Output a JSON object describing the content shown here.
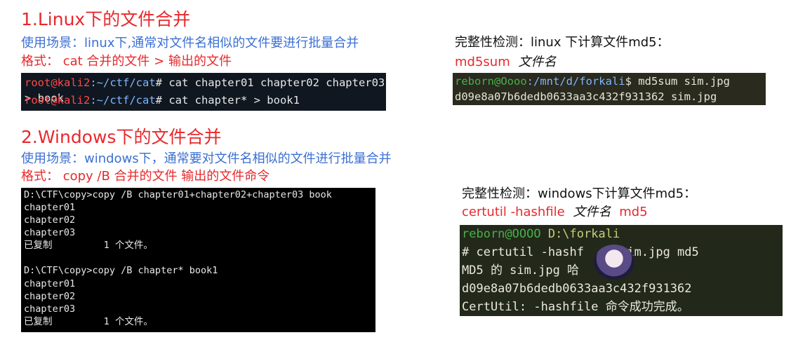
{
  "section1": {
    "title": "1.Linux下的文件合并",
    "usage": "使用场景：linux下,通常对文件名相似的文件要进行批量合并",
    "format": "格式： cat 合并的文件 > 输出的文件",
    "terminal": {
      "line1_prompt_user": "root@kali2",
      "line1_prompt_path": ":~/ctf/cat",
      "line1_cmd": "# cat chapter01 chapter02 chapter03 > book",
      "line2_prompt_user": "root@kali2",
      "line2_prompt_path": ":~/ctf/cat",
      "line2_cmd": "# cat chapter* > book1"
    }
  },
  "integrity_linux": {
    "title": "完整性检测：linux 下计算文件md5：",
    "cmd_label": "md5sum",
    "cmd_arg": "文件名",
    "terminal": {
      "prompt_user": "reborn@Oooo",
      "prompt_path": ":/mnt/d/forkali",
      "prompt_cmd": "$ md5sum sim.jpg",
      "output": "d09e8a07b6dedb0633aa3c432f931362  sim.jpg"
    }
  },
  "section2": {
    "title": "2.Windows下的文件合并",
    "usage": "使用场景：windows下，通常要对文件名相似的文件进行批量合并",
    "format": "格式： copy /B 合并的文件 输出的文件命令",
    "terminal": {
      "lines": [
        "D:\\CTF\\copy>copy /B chapter01+chapter02+chapter03 book",
        "chapter01",
        "chapter02",
        "chapter03",
        "已复制         1 个文件。",
        "",
        "D:\\CTF\\copy>copy /B chapter* book1",
        "chapter01",
        "chapter02",
        "chapter03",
        "已复制         1 个文件。"
      ]
    }
  },
  "integrity_windows": {
    "title": "完整性检测：windows下计算文件md5：",
    "cmd_label": "certutil -hashfile",
    "cmd_arg": "文件名",
    "cmd_tail": "md5",
    "terminal": {
      "prompt_user": "reborn@OOOO",
      "prompt_path": " D:\\forkali",
      "lines": [
        "# certutil -hashf     sim.jpg md5",
        "MD5 的 sim.jpg 哈",
        "d09e8a07b6dedb0633aa3c432f931362",
        "CertUtil: -hashfile 命令成功完成。"
      ]
    }
  }
}
